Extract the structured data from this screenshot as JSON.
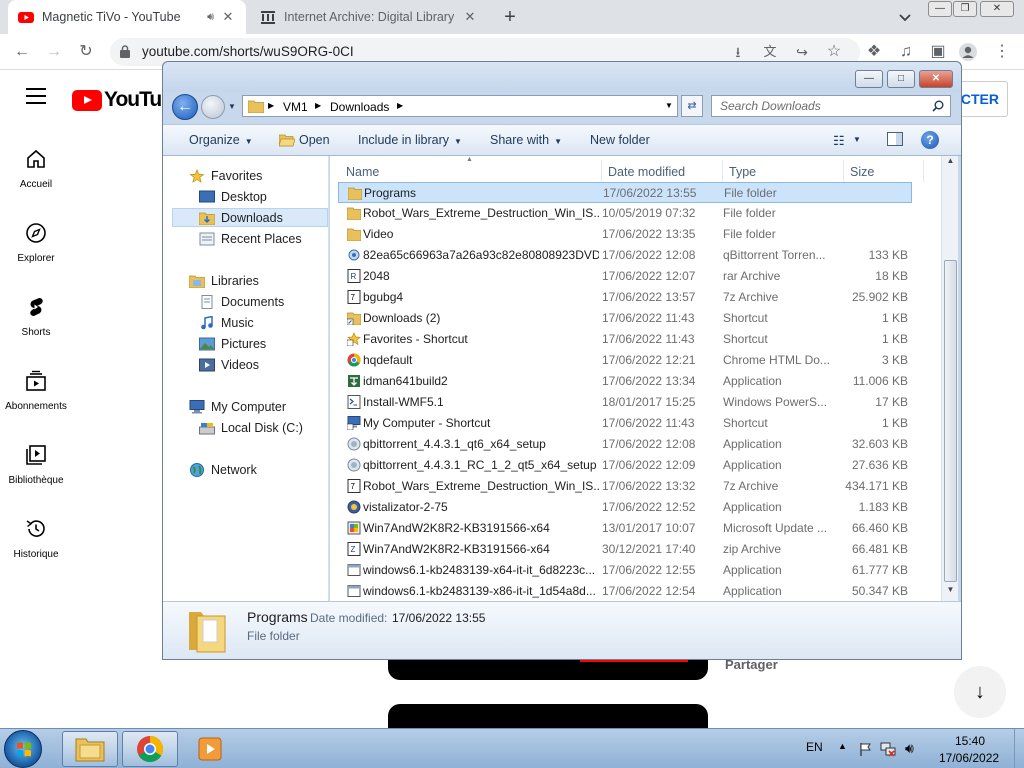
{
  "browser": {
    "tabs": [
      {
        "title": "Magnetic TiVo - YouTube",
        "active": true,
        "audio": true
      },
      {
        "title": "Internet Archive: Digital Library o",
        "active": false,
        "audio": false
      }
    ],
    "url": "youtube.com/shorts/wuS9ORG-0CI",
    "new_tab_label": "+"
  },
  "youtube": {
    "logo_text": "YouTube",
    "signin_label": "CTER",
    "sidebar": [
      {
        "label": "Accueil",
        "icon": "home-icon"
      },
      {
        "label": "Explorer",
        "icon": "compass-icon"
      },
      {
        "label": "Shorts",
        "icon": "shorts-icon"
      },
      {
        "label": "Abonnements",
        "icon": "subscriptions-icon"
      },
      {
        "label": "Bibliothèque",
        "icon": "library-icon"
      },
      {
        "label": "Historique",
        "icon": "history-icon"
      }
    ],
    "share_label": "Partager",
    "down_label": "↓"
  },
  "explorer": {
    "breadcrumb": [
      "VM1",
      "Downloads"
    ],
    "search_placeholder": "Search Downloads",
    "commands": [
      "Organize",
      "Open",
      "Include in library",
      "Share with",
      "New folder"
    ],
    "nav": {
      "favorites": {
        "label": "Favorites",
        "items": [
          "Desktop",
          "Downloads",
          "Recent Places"
        ],
        "selected": "Downloads"
      },
      "libraries": {
        "label": "Libraries",
        "items": [
          "Documents",
          "Music",
          "Pictures",
          "Videos"
        ]
      },
      "computer": {
        "label": "My Computer",
        "items": [
          "Local Disk (C:)"
        ]
      },
      "network": {
        "label": "Network"
      }
    },
    "columns": [
      "Name",
      "Date modified",
      "Type",
      "Size"
    ],
    "files": [
      {
        "name": "Programs",
        "date": "17/06/2022 13:55",
        "type": "File folder",
        "size": "",
        "icon": "folder-icon"
      },
      {
        "name": "Robot_Wars_Extreme_Destruction_Win_IS...",
        "date": "10/05/2019 07:32",
        "type": "File folder",
        "size": "",
        "icon": "folder-icon"
      },
      {
        "name": "Video",
        "date": "17/06/2022 13:35",
        "type": "File folder",
        "size": "",
        "icon": "folder-icon"
      },
      {
        "name": "82ea65c66963a7a26a93c82e80808923DVD...",
        "date": "17/06/2022 12:08",
        "type": "qBittorrent Torren...",
        "size": "133 KB",
        "icon": "torrent-icon"
      },
      {
        "name": "2048",
        "date": "17/06/2022 12:07",
        "type": "rar Archive",
        "size": "18 KB",
        "icon": "rar-icon"
      },
      {
        "name": "bgubg4",
        "date": "17/06/2022 13:57",
        "type": "7z Archive",
        "size": "25.902 KB",
        "icon": "archive-icon"
      },
      {
        "name": "Downloads (2)",
        "date": "17/06/2022 11:43",
        "type": "Shortcut",
        "size": "1 KB",
        "icon": "shortcut-folder-icon"
      },
      {
        "name": "Favorites - Shortcut",
        "date": "17/06/2022 11:43",
        "type": "Shortcut",
        "size": "1 KB",
        "icon": "star-shortcut-icon"
      },
      {
        "name": "hqdefault",
        "date": "17/06/2022 12:21",
        "type": "Chrome HTML Do...",
        "size": "3 KB",
        "icon": "chrome-icon"
      },
      {
        "name": "idman641build2",
        "date": "17/06/2022 13:34",
        "type": "Application",
        "size": "11.006 KB",
        "icon": "idm-icon"
      },
      {
        "name": "Install-WMF5.1",
        "date": "18/01/2017 15:25",
        "type": "Windows PowerS...",
        "size": "17 KB",
        "icon": "powershell-icon"
      },
      {
        "name": "My Computer - Shortcut",
        "date": "17/06/2022 11:43",
        "type": "Shortcut",
        "size": "1 KB",
        "icon": "computer-shortcut-icon"
      },
      {
        "name": "qbittorrent_4.4.3.1_qt6_x64_setup",
        "date": "17/06/2022 12:08",
        "type": "Application",
        "size": "32.603 KB",
        "icon": "installer-icon"
      },
      {
        "name": "qbittorrent_4.4.3.1_RC_1_2_qt5_x64_setup",
        "date": "17/06/2022 12:09",
        "type": "Application",
        "size": "27.636 KB",
        "icon": "installer-icon"
      },
      {
        "name": "Robot_Wars_Extreme_Destruction_Win_IS...",
        "date": "17/06/2022 13:32",
        "type": "7z Archive",
        "size": "434.171 KB",
        "icon": "archive-icon"
      },
      {
        "name": "vistalizator-2-75",
        "date": "17/06/2022 12:52",
        "type": "Application",
        "size": "1.183 KB",
        "icon": "app-icon"
      },
      {
        "name": "Win7AndW2K8R2-KB3191566-x64",
        "date": "13/01/2017 10:07",
        "type": "Microsoft Update ...",
        "size": "66.460 KB",
        "icon": "update-icon"
      },
      {
        "name": "Win7AndW2K8R2-KB3191566-x64",
        "date": "30/12/2021 17:40",
        "type": "zip Archive",
        "size": "66.481 KB",
        "icon": "zip-icon"
      },
      {
        "name": "windows6.1-kb2483139-x64-it-it_6d8223c...",
        "date": "17/06/2022 12:55",
        "type": "Application",
        "size": "61.777 KB",
        "icon": "app-window-icon"
      },
      {
        "name": "windows6.1-kb2483139-x86-it-it_1d54a8d...",
        "date": "17/06/2022 12:54",
        "type": "Application",
        "size": "50.347 KB",
        "icon": "app-window-icon"
      }
    ],
    "selected_index": 0,
    "details": {
      "name": "Programs",
      "date_label": "Date modified:",
      "date_value": "17/06/2022 13:55",
      "type": "File folder"
    }
  },
  "taskbar": {
    "language": "EN",
    "time": "15:40",
    "date": "17/06/2022"
  },
  "colors": {
    "youtube_red": "#ff0000",
    "explorer_selection": "#cce4fb",
    "taskbar": "#a9c4e2"
  }
}
